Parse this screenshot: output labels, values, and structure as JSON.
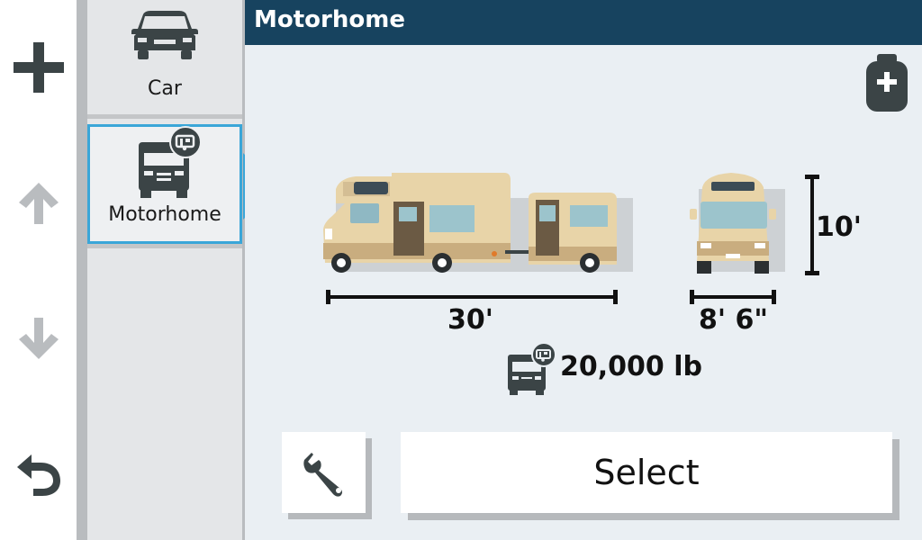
{
  "header": {
    "title": "Motorhome"
  },
  "left_nav": [
    {
      "icon": "plus-icon"
    },
    {
      "icon": "arrow-up-icon"
    },
    {
      "icon": "arrow-down-icon"
    },
    {
      "icon": "back-icon"
    }
  ],
  "profiles": [
    {
      "label": "Car",
      "icon": "car-icon",
      "selected": false
    },
    {
      "label": "Motorhome",
      "icon": "motorhome-icon",
      "selected": true
    }
  ],
  "vehicle": {
    "length": "30'",
    "width": "8' 6\"",
    "height": "10'",
    "weight": "20,000 lb"
  },
  "buttons": {
    "select_label": "Select",
    "settings_icon": "wrench-icon",
    "propane_icon": "propane-tank-add-icon"
  },
  "colors": {
    "header": "#17435f",
    "accent": "#3aa6d8",
    "icon_dark": "#3b4446",
    "vehicle_body": "#e8d4a8"
  }
}
